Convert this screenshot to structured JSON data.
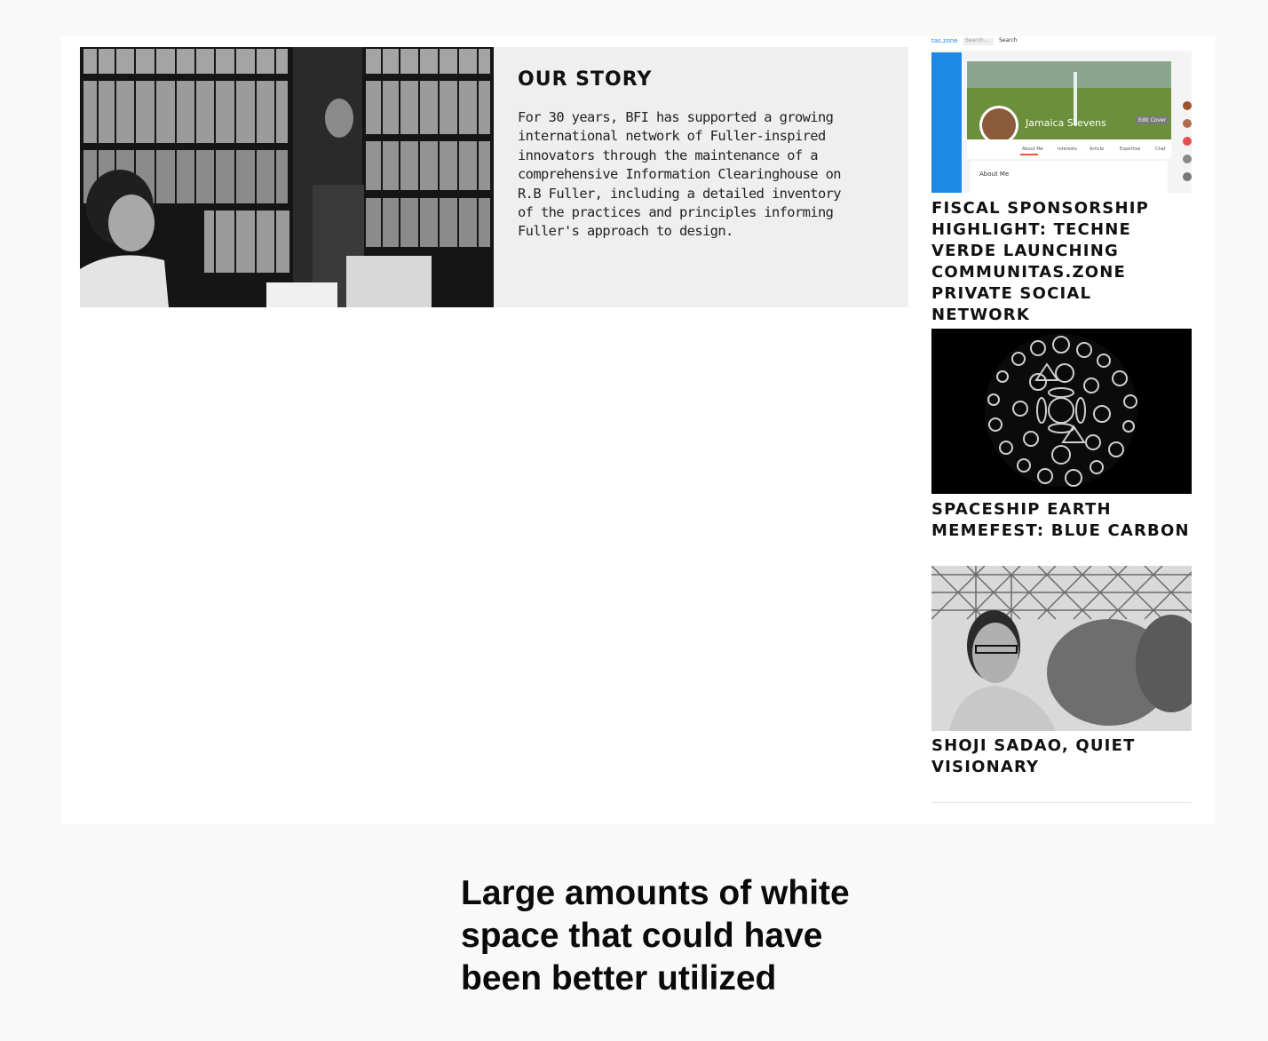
{
  "story": {
    "heading": "OUR STORY",
    "body": "For 30 years, BFI has supported a growing international network of Fuller-inspired innovators through the maintenance of a comprehensive Information Clearinghouse on R.B Fuller, including a detailed inventory of the practices and principles informing Fuller's approach to design."
  },
  "sidebar": {
    "items": [
      {
        "title": "FISCAL SPONSORSHIP HIGHLIGHT: TECHNE VERDE LAUNCHING COMMUNITAS.ZONE PRIVATE SOCIAL NETWORK",
        "thumb_topbar": {
          "logo": "tas.zone",
          "search": "Search...",
          "search_button": "Search"
        },
        "thumb_profile_name": "Jamaica Stevens",
        "thumb_edit": "Edit Cover",
        "thumb_tabs": [
          "About Me",
          "Interests",
          "Article",
          "Expertise",
          "Chat"
        ],
        "thumb_section": "About Me"
      },
      {
        "title": "SPACESHIP EARTH MEMEFEST: BLUE CARBON"
      },
      {
        "title": "SHOJI SADAO, QUIET VISIONARY"
      }
    ]
  },
  "annotation": "Large amounts of white space that could have been better utilized"
}
